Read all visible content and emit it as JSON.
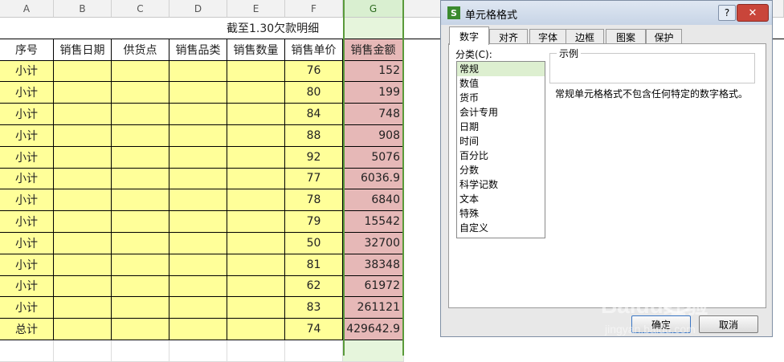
{
  "columns": [
    "A",
    "B",
    "C",
    "D",
    "E",
    "F",
    "G"
  ],
  "title_row": "截至1.30欠款明细",
  "headers": [
    "序号",
    "销售日期",
    "供货点",
    "销售品类",
    "销售数量",
    "销售单价",
    "销售金额"
  ],
  "rows": [
    {
      "seq": "小计",
      "price": "76",
      "amount": "152"
    },
    {
      "seq": "小计",
      "price": "80",
      "amount": "199"
    },
    {
      "seq": "小计",
      "price": "84",
      "amount": "748"
    },
    {
      "seq": "小计",
      "price": "88",
      "amount": "908"
    },
    {
      "seq": "小计",
      "price": "92",
      "amount": "5076"
    },
    {
      "seq": "小计",
      "price": "77",
      "amount": "6036.9"
    },
    {
      "seq": "小计",
      "price": "78",
      "amount": "6840"
    },
    {
      "seq": "小计",
      "price": "79",
      "amount": "15542"
    },
    {
      "seq": "小计",
      "price": "50",
      "amount": "32700"
    },
    {
      "seq": "小计",
      "price": "81",
      "amount": "38348"
    },
    {
      "seq": "小计",
      "price": "62",
      "amount": "61972"
    },
    {
      "seq": "小计",
      "price": "83",
      "amount": "261121"
    },
    {
      "seq": "总计",
      "price": "74",
      "amount": "429642.9"
    }
  ],
  "dialog": {
    "title": "单元格格式",
    "help": "?",
    "close": "✕",
    "tabs": [
      "数字",
      "对齐",
      "字体",
      "边框",
      "图案",
      "保护"
    ],
    "active_tab": "数字",
    "category_label": "分类(C):",
    "categories": [
      "常规",
      "数值",
      "货币",
      "会计专用",
      "日期",
      "时间",
      "百分比",
      "分数",
      "科学记数",
      "文本",
      "特殊",
      "自定义"
    ],
    "selected_category": "常规",
    "sample_label": "示例",
    "description": "常规单元格格式不包含任何特定的数字格式。",
    "ok": "确定",
    "cancel": "取消"
  },
  "watermark": {
    "brand": "Baidu经验",
    "url": "jingyan.baidu.com"
  }
}
